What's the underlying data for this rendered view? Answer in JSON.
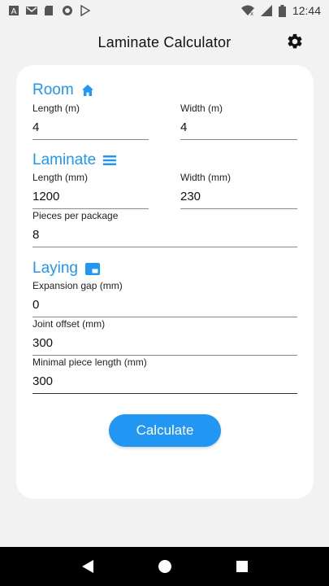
{
  "status_bar": {
    "time": "12:44",
    "left_icons": [
      "text-a-icon",
      "gmail-icon",
      "sd-card-icon",
      "circle-icon",
      "play-store-icon"
    ],
    "right_icons": [
      "wifi-icon",
      "signal-icon",
      "battery-icon"
    ]
  },
  "app_bar": {
    "title": "Laminate Calculator",
    "settings_icon": "gear-icon"
  },
  "sections": {
    "room": {
      "title": "Room",
      "icon": "home-icon",
      "length_label": "Length (m)",
      "length_value": "4",
      "width_label": "Width (m)",
      "width_value": "4"
    },
    "laminate": {
      "title": "Laminate",
      "icon": "list-icon",
      "length_label": "Length (mm)",
      "length_value": "1200",
      "width_label": "Width (mm)",
      "width_value": "230",
      "pieces_label": "Pieces per package",
      "pieces_value": "8"
    },
    "laying": {
      "title": "Laying",
      "icon": "laying-icon",
      "gap_label": "Expansion gap (mm)",
      "gap_value": "0",
      "offset_label": "Joint offset (mm)",
      "offset_value": "300",
      "minpiece_label": "Minimal piece length (mm)",
      "minpiece_value": "300"
    }
  },
  "calculate_button": "Calculate",
  "colors": {
    "accent": "#2196f3",
    "background": "#f2f2f2",
    "card": "#ffffff",
    "nav_bar": "#000000"
  }
}
